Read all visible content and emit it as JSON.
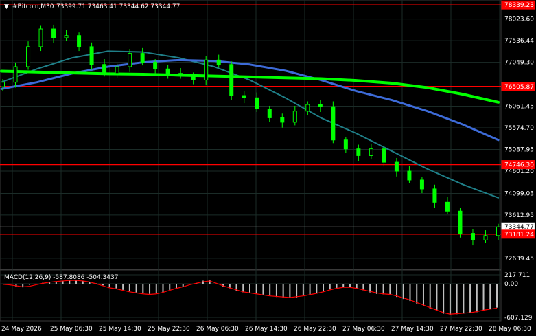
{
  "header": {
    "menu_arrow": "▼",
    "symbol_label": "#Bitcoin,M30",
    "ohlc": "73399.71 73463.41 73344.62 73344.77"
  },
  "price_axis": {
    "ticks": [
      "78023.60",
      "77536.44",
      "77049.30",
      "76061.45",
      "75574.70",
      "75087.95",
      "74601.20",
      "74099.03",
      "73612.95",
      "72639.45"
    ]
  },
  "price_marks": [
    {
      "label": "78339.23",
      "style": "red-box",
      "color": "#ff0000"
    },
    {
      "label": "76505.87",
      "style": "red-box",
      "color": "#ff0000"
    },
    {
      "label": "74746.30",
      "style": "red-box",
      "color": "#ff0000"
    },
    {
      "label": "73344.77",
      "style": "white-box",
      "color": "#ffffff"
    },
    {
      "label": "73181.24",
      "style": "red-box",
      "color": "#ff0000"
    }
  ],
  "macd": {
    "label": "MACD(12,26,9) -587.8086 -504.3437",
    "ticks": [
      "217.711",
      "0.00",
      "-607.129"
    ]
  },
  "time_axis": {
    "labels": [
      "24 May 2026",
      "25 May 06:30",
      "25 May 14:30",
      "25 May 22:30",
      "26 May 06:30",
      "26 May 14:30",
      "26 May 22:30",
      "27 May 06:30",
      "27 May 14:30",
      "27 May 22:30",
      "28 May 06:30"
    ]
  },
  "colors": {
    "background": "#000000",
    "candle": "#00ff00",
    "horizontal_levels": "#ff0000",
    "ma_fast": "#00ff00",
    "ma_mid": "#3d6bd8",
    "ma_slow": "#1f7f88",
    "macd_hist": "#c0c0c0",
    "macd_signal": "#ff0000",
    "grid": "#1b2c28"
  },
  "chart_data": {
    "type": "candlestick",
    "symbol": "#Bitcoin",
    "timeframe": "M30",
    "ylim": [
      72390,
      78450
    ],
    "x": [
      "24 May 2026",
      "25 May 06:30",
      "25 May 14:30",
      "25 May 22:30",
      "26 May 06:30",
      "26 May 14:30",
      "26 May 22:30",
      "27 May 06:30",
      "27 May 14:30",
      "27 May 22:30",
      "28 May 06:30"
    ],
    "close_series": [
      76600,
      76950,
      77400,
      77800,
      77600,
      77650,
      77400,
      77000,
      76800,
      76950,
      77250,
      77050,
      76900,
      76800,
      76750,
      76650,
      77100,
      77000,
      76300,
      76250,
      76000,
      75800,
      75700,
      75950,
      76100,
      76050,
      75300,
      75100,
      74950,
      75100,
      74800,
      74600,
      74400,
      74200,
      73900,
      73700,
      73200,
      73050,
      73150,
      73344.77
    ],
    "horizontal_levels": [
      78339.23,
      76505.87,
      74746.3,
      73181.24
    ],
    "current_price": 73344.77,
    "moving_averages": [
      {
        "color": "#00ff00",
        "values": [
          76850,
          76830,
          76810,
          76790,
          76780,
          76760,
          76740,
          76720,
          76700,
          76680,
          76640,
          76580,
          76480,
          76330,
          76150
        ]
      },
      {
        "color": "#3d6bd8",
        "values": [
          76450,
          76600,
          76800,
          76950,
          77050,
          77100,
          77080,
          77000,
          76860,
          76650,
          76400,
          76200,
          75950,
          75650,
          75300
        ]
      },
      {
        "color": "#1f7f88",
        "values": [
          76600,
          76900,
          77150,
          77300,
          77280,
          77150,
          76950,
          76650,
          76250,
          75800,
          75450,
          75050,
          74650,
          74300,
          74000
        ]
      }
    ],
    "macd_histogram": [
      -10,
      -20,
      -60,
      -70,
      -20,
      0,
      20,
      30,
      40,
      60,
      70,
      70,
      60,
      40,
      10,
      -30,
      -70,
      -90,
      -120,
      -150,
      -170,
      -190,
      -200,
      -190,
      -170,
      -120,
      -90,
      -60,
      -20,
      10,
      60,
      80,
      -10,
      -60,
      -90,
      -140,
      -170,
      -180,
      -200,
      -220,
      -240,
      -260,
      -270,
      -280,
      -270,
      -240,
      -220,
      -190,
      -160,
      -110,
      -80,
      -60,
      -70,
      -90,
      -130,
      -170,
      -200,
      -210,
      -220,
      -260,
      -300,
      -340,
      -390,
      -440,
      -490,
      -540,
      -590,
      -610,
      -600,
      -590,
      -580,
      -560,
      -530,
      -500,
      -470
    ],
    "macd_signal": [
      -10,
      -20,
      -40,
      -60,
      -50,
      -20,
      10,
      30,
      45,
      55,
      65,
      65,
      55,
      35,
      0,
      -40,
      -80,
      -100,
      -130,
      -160,
      -180,
      -200,
      -210,
      -200,
      -170,
      -130,
      -90,
      -60,
      -20,
      10,
      40,
      55,
      10,
      -40,
      -80,
      -120,
      -160,
      -180,
      -200,
      -220,
      -240,
      -250,
      -260,
      -270,
      -255,
      -240,
      -215,
      -190,
      -160,
      -120,
      -90,
      -70,
      -70,
      -90,
      -120,
      -150,
      -180,
      -200,
      -210,
      -240,
      -280,
      -320,
      -370,
      -420,
      -470,
      -520,
      -570,
      -600,
      -590,
      -580,
      -570,
      -550,
      -520,
      -500,
      -480
    ]
  }
}
